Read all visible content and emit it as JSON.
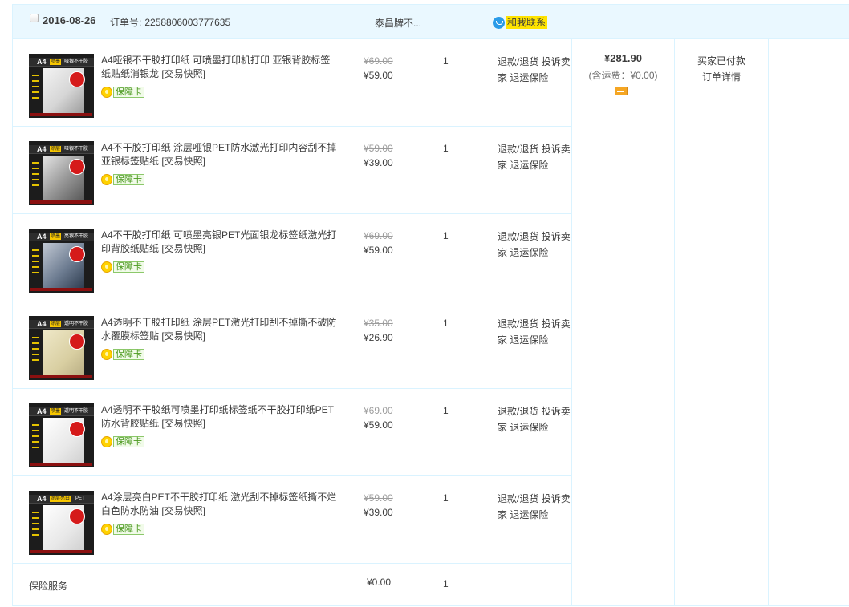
{
  "header": {
    "date": "2016-08-26",
    "order_label": "订单号:",
    "order_number": "2258806003777635",
    "shop_name": "泰昌牌不...",
    "contact_label": "和我联系"
  },
  "items": [
    {
      "title": "A4哑银不干胶打印纸 可喷墨打印机打印 亚银背胶标签纸贴纸消银龙 [交易快照]",
      "guarantee": "保障卡",
      "original_price": "¥69.00",
      "price": "¥59.00",
      "quantity": "1",
      "ops": [
        "退款/退货",
        "投诉卖家",
        "退运保险"
      ],
      "thumb_text": "A4",
      "thumb_tag": "喷墨",
      "thumb_title": "哑银不干胶"
    },
    {
      "title": "A4不干胶打印纸 涂层哑银PET防水激光打印内容刮不掉 亚银标签贴纸 [交易快照]",
      "guarantee": "保障卡",
      "original_price": "¥59.00",
      "price": "¥39.00",
      "quantity": "1",
      "ops": [
        "退款/退货",
        "投诉卖家",
        "退运保险"
      ],
      "thumb_text": "A4",
      "thumb_tag": "涂层",
      "thumb_title": "哑银不干胶"
    },
    {
      "title": "A4不干胶打印纸 可喷墨亮银PET光面银龙标签纸激光打印背胶纸贴纸 [交易快照]",
      "guarantee": "保障卡",
      "original_price": "¥69.00",
      "price": "¥59.00",
      "quantity": "1",
      "ops": [
        "退款/退货",
        "投诉卖家",
        "退运保险"
      ],
      "thumb_text": "A4",
      "thumb_tag": "喷墨",
      "thumb_title": "亮银不干胶"
    },
    {
      "title": "A4透明不干胶打印纸 涂层PET激光打印刮不掉撕不破防水覆膜标签贴 [交易快照]",
      "guarantee": "保障卡",
      "original_price": "¥35.00",
      "price": "¥26.90",
      "quantity": "1",
      "ops": [
        "退款/退货",
        "投诉卖家",
        "退运保险"
      ],
      "thumb_text": "A4",
      "thumb_tag": "涂层",
      "thumb_title": "透明不干胶"
    },
    {
      "title": "A4透明不干胶纸可喷墨打印纸标签纸不干胶打印纸PET防水背胶贴纸 [交易快照]",
      "guarantee": "保障卡",
      "original_price": "¥69.00",
      "price": "¥59.00",
      "quantity": "1",
      "ops": [
        "退款/退货",
        "投诉卖家",
        "退运保险"
      ],
      "thumb_text": "A4",
      "thumb_tag": "喷墨",
      "thumb_title": "透明不干胶"
    },
    {
      "title": "A4涂层亮白PET不干胶打印纸 激光刮不掉标签纸撕不烂白色防水防油 [交易快照]",
      "guarantee": "保障卡",
      "original_price": "¥59.00",
      "price": "¥39.00",
      "quantity": "1",
      "ops": [
        "退款/退货",
        "投诉卖家",
        "退运保险"
      ],
      "thumb_text": "A4",
      "thumb_tag": "涂层亮白",
      "thumb_title": "PET"
    }
  ],
  "insurance": {
    "label": "保险服务",
    "price": "¥0.00",
    "quantity": "1"
  },
  "summary": {
    "total": "¥281.90",
    "shipping": "(含运费：¥0.00)",
    "status": "买家已付款",
    "detail_link": "订单详情"
  },
  "colors": {
    "border": "#daf3ff",
    "header_bg": "#eaf8ff",
    "contact_highlight": "#ffe400",
    "guarantee_green": "#4c9a20"
  }
}
